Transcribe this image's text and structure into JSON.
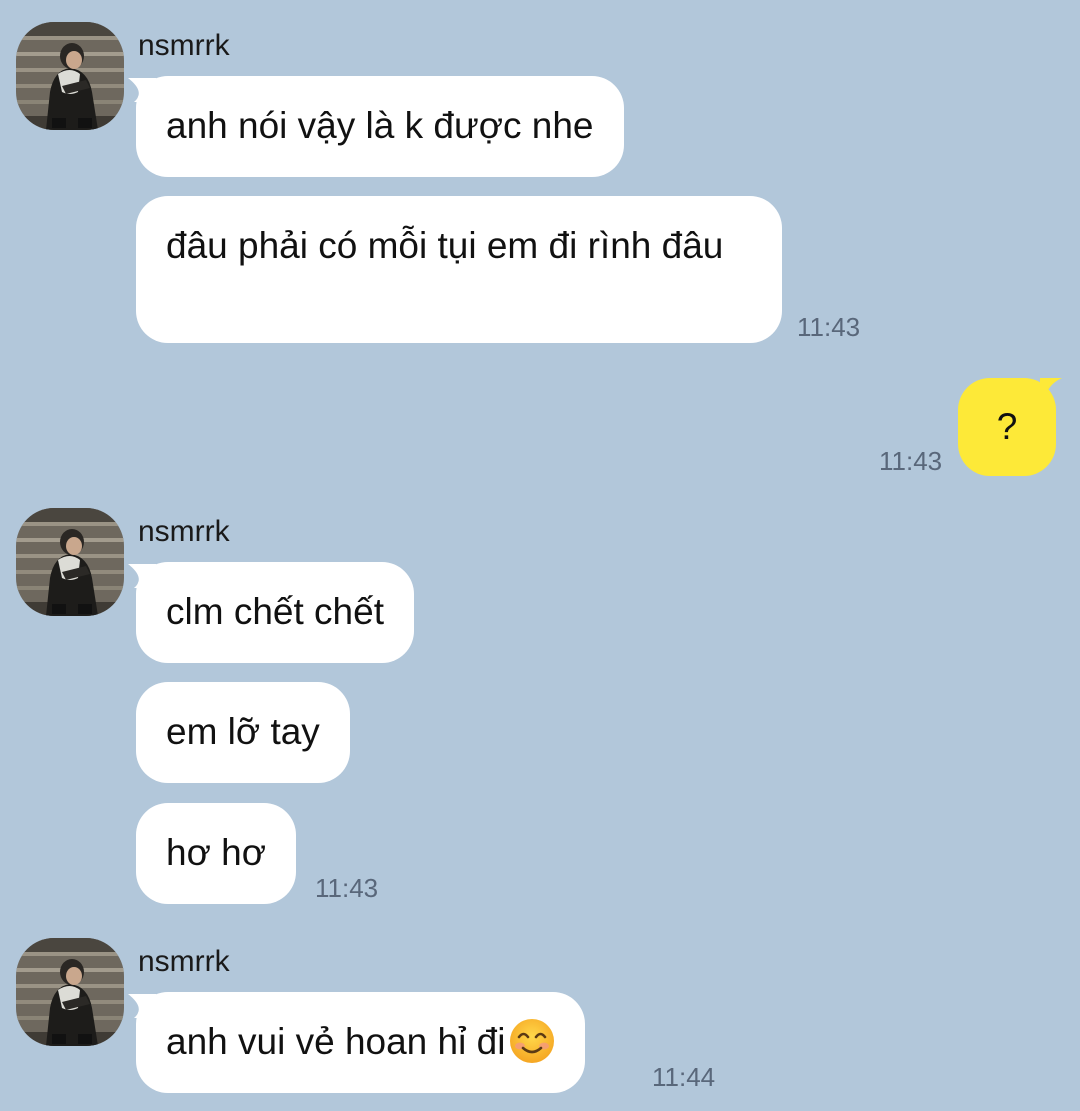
{
  "chat": {
    "groups": [
      {
        "sender": "nsmrrk",
        "avatar": "user-photo-avatar",
        "messages": [
          {
            "text": "anh nói vậy là k được nhe"
          },
          {
            "text": "đâu phải có mỗi tụi em đi rình đâu"
          }
        ],
        "time": "11:43"
      },
      {
        "sender": "nsmrrk",
        "avatar": "user-photo-avatar",
        "messages": [
          {
            "text": "clm chết chết"
          },
          {
            "text": "em lỡ tay"
          },
          {
            "text": "hơ hơ"
          }
        ],
        "time": "11:43"
      },
      {
        "sender": "nsmrrk",
        "avatar": "user-photo-avatar",
        "messages": [
          {
            "text": "anh vui vẻ hoan hỉ đi",
            "emoji": "smiling-face-emoji"
          }
        ],
        "time": "11:44"
      }
    ],
    "outgoing": [
      {
        "text": "?",
        "time": "11:43"
      }
    ]
  },
  "colors": {
    "background": "#b2c7da",
    "incoming_bubble": "#ffffff",
    "outgoing_bubble": "#fde938",
    "timestamp": "#59677a"
  }
}
